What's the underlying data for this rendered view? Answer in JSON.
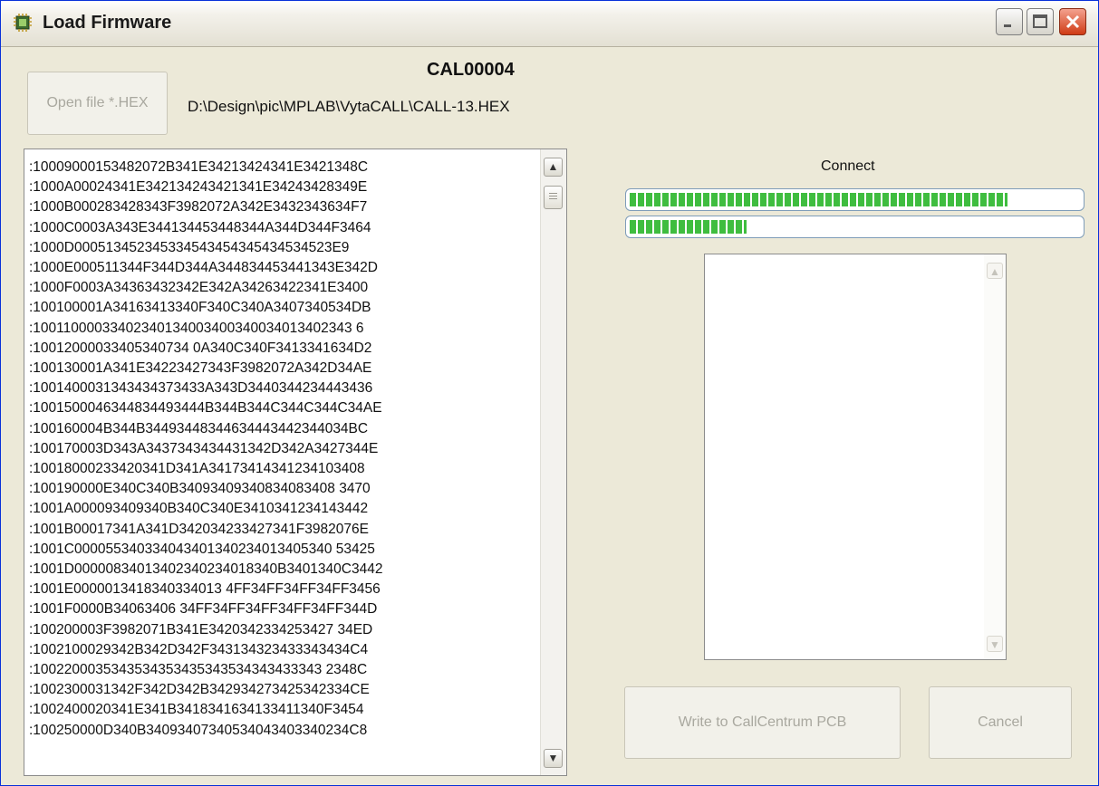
{
  "window": {
    "title": "Load Firmware"
  },
  "device_name": "CAL00004",
  "file_path": "D:\\Design\\pic\\MPLAB\\VytaCALL\\CALL-13.HEX",
  "buttons": {
    "open": "Open file *.HEX",
    "write": "Write to CallCentrum PCB",
    "cancel": "Cancel"
  },
  "connect_label": "Connect",
  "progress": {
    "bar1": 0.84,
    "bar2": 0.26
  },
  "hex_lines": [
    ":10009000153482072B341E34213424341E3421348C",
    ":1000A00024341E342134243421341E34243428349E",
    ":1000B000283428343F3982072A342E3432343634F7",
    ":1000C0003A343E344134453448344A344D344F3464",
    ":1000D000513452345334543454345434534523E9",
    ":1000E000511344F344D344A344834453441343E342D",
    ":1000F0003A34363432342E342A34263422341E3400",
    ":100100001A34163413340F340C340A3407340534DB",
    ":10011000033402340134003400340034013402343 6",
    ":10012000033405340734 0A340C340F3413341634D2",
    ":100130001A341E34223427343F3982072A342D34AE",
    ":1001400031343434373433A343D3440344234443436",
    ":1001500046344834493444B344B344C344C344C34AE",
    ":100160004B344B34493448344634443442344034BC",
    ":100170003D343A3437343434431342D342A3427344E",
    ":10018000233420341D341A34173414341234103408",
    ":100190000E340C340B34093409340834083408 3470",
    ":1001A000093409340B340C340E3410341234143442",
    ":1001B00017341A341D342034233427341F3982076E",
    ":1001C000055340334043401340234013405340 53425",
    ":1001D00000834013402340234018340B3401340C3442",
    ":1001E0000013418340334013 4FF34FF34FF34FF3456",
    ":1001F0000B34063406 34FF34FF34FF34FF34FF344D",
    ":100200003F3982071B341E3420342334253427 34ED",
    ":1002100029342B342D342F343134323433343434C4",
    ":1002200035343534353435343534343433343 2348C",
    ":1002300031342F342D342B342934273425342334CE",
    ":1002400020341E341B3418341634133411340F3454",
    ":100250000D340B34093407340534043403340234C8"
  ]
}
